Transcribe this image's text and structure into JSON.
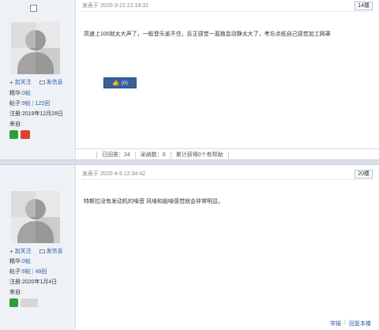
{
  "posts": [
    {
      "user": {
        "follow": "加关注",
        "message": "发信息",
        "jinghua_label": "精华:",
        "jinghua_value": "0帖",
        "tiezi_label": "帖子:",
        "tiezi_value": "9帖",
        "tiezi_sep": "|",
        "tiezi_extra": "122回",
        "reg_label": "注册:",
        "reg_value": "2019年12月28日",
        "from_label": "来自:"
      },
      "posted": "发表于 2020-3-22 22:19:32",
      "floor": "14楼",
      "content": "高速上100就太大声了，一般音乐盖不住，反正感觉一直跑怠动静太大了，考忘点纸自己感觉加工网罩",
      "like": "(0)",
      "stats": {
        "replies": "已回答：24",
        "adopted": "采纳数：0",
        "helpful": "累计获得0个有帮助"
      }
    },
    {
      "user": {
        "follow": "加关注",
        "message": "发信息",
        "jinghua_label": "精华:",
        "jinghua_value": "0帖",
        "tiezi_label": "帖子:",
        "tiezi_value": "6帖",
        "tiezi_sep": "|",
        "tiezi_extra": "49回",
        "reg_label": "注册:",
        "reg_value": "2020年1月4日",
        "from_label": "来自:"
      },
      "posted": "发表于 2020-4-5 12:34:42",
      "floor": "20楼",
      "content": "特斯拉没有发动机的噪音 风噪和胎噪感觉就会非常明显。",
      "footer": {
        "report": "举报",
        "back_top": "回复本楼"
      }
    }
  ],
  "colors": {
    "accent": "#2c5aa0",
    "like_button": "#3a5f9c",
    "sidebar_bg": "#eef2f7"
  }
}
